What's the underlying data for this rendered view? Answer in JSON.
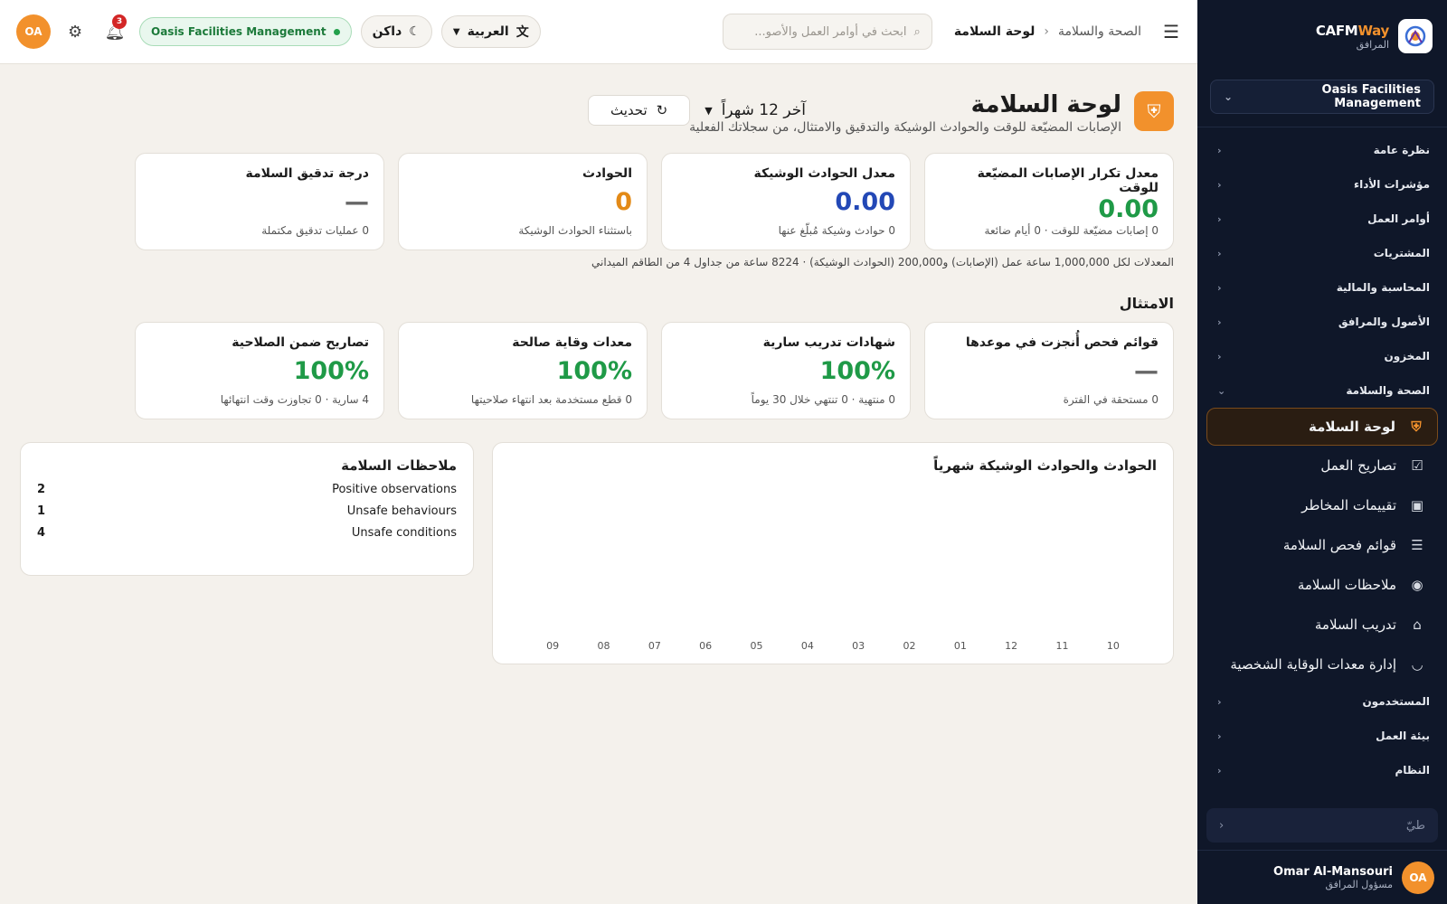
{
  "sidebar": {
    "brand": {
      "name_a": "CAFM",
      "name_b": "Way",
      "sub": "المرافق"
    },
    "tenant": "Oasis Facilities Management",
    "groups_top": [
      {
        "label": "نظرة عامة"
      },
      {
        "label": "مؤشرات الأداء"
      },
      {
        "label": "أوامر العمل"
      },
      {
        "label": "المشتريات"
      },
      {
        "label": "المحاسبة والمالية"
      },
      {
        "label": "الأصول والمرافق"
      },
      {
        "label": "المخزون"
      },
      {
        "label": "الصحة والسلامة"
      }
    ],
    "sub_items": [
      {
        "label": "لوحة السلامة",
        "icon": "shield-icon"
      },
      {
        "label": "تصاريح العمل",
        "icon": "checkbox-icon"
      },
      {
        "label": "تقييمات المخاطر",
        "icon": "chart-box-icon"
      },
      {
        "label": "قوائم فحص السلامة",
        "icon": "checklist-icon"
      },
      {
        "label": "ملاحظات السلامة",
        "icon": "eye-icon"
      },
      {
        "label": "تدريب السلامة",
        "icon": "graduation-cap-icon"
      },
      {
        "label": "إدارة معدات الوقاية الشخصية",
        "icon": "mask-icon"
      }
    ],
    "groups_bottom": [
      {
        "label": "المستخدمون"
      },
      {
        "label": "بيئة العمل"
      },
      {
        "label": "النظام"
      }
    ],
    "collapse_label": "طيّ",
    "user": {
      "initials": "OA",
      "name": "Omar Al-Mansouri",
      "role": "مسؤول المرافق"
    }
  },
  "topbar": {
    "breadcrumb_parent": "الصحة والسلامة",
    "breadcrumb_current": "لوحة السلامة",
    "search_placeholder": "ابحث في أوامر العمل والأصو...",
    "language": "العربية",
    "theme": "داكن",
    "tenant": "Oasis Facilities Management",
    "notifications": "3",
    "user_initials": "OA"
  },
  "page": {
    "title": "لوحة السلامة",
    "subtitle": "الإصابات المضيّعة للوقت والحوادث الوشيكة والتدقيق والامتثال، من سجلاتك الفعلية",
    "period": "آخر 12 شهراً",
    "refresh": "تحديث"
  },
  "kpis": [
    {
      "title": "معدل تكرار الإصابات المضيّعة للوقت",
      "value": "0.00",
      "note": "0 إصابات مضيّعة للوقت · 0 أيام ضائعة",
      "color": "#1f9a47"
    },
    {
      "title": "معدل الحوادث الوشيكة",
      "value": "0.00",
      "note": "0 حوادث وشيكة مُبلّغ عنها",
      "color": "#2348b6"
    },
    {
      "title": "الحوادث",
      "value": "0",
      "note": "باستثناء الحوادث الوشيكة",
      "color": "#e38a17"
    },
    {
      "title": "درجة تدقيق السلامة",
      "value": "—",
      "note": "0 عمليات تدقيق مكتملة",
      "color": "#666666"
    }
  ],
  "rates_note": "المعدلات لكل 1,000,000 ساعة عمل (الإصابات) و200,000 (الحوادث الوشيكة) · 8224 ساعة من جداول 4 من الطاقم الميداني",
  "compliance": {
    "title": "الامتثال",
    "cards": [
      {
        "title": "قوائم فحص أُنجزت في موعدها",
        "value": "—",
        "note": "0 مستحقة في الفترة",
        "color": "#666666"
      },
      {
        "title": "شهادات تدريب سارية",
        "value": "100%",
        "note": "0 منتهية · 0 تنتهي خلال 30 يوماً",
        "color": "#1f9a47"
      },
      {
        "title": "معدات وقاية صالحة",
        "value": "100%",
        "note": "0 قطع مستخدمة بعد انتهاء صلاحيتها",
        "color": "#1f9a47"
      },
      {
        "title": "تصاريح ضمن الصلاحية",
        "value": "100%",
        "note": "4 سارية · 0 تجاوزت وقت انتهائها",
        "color": "#1f9a47"
      }
    ]
  },
  "chart_data": {
    "type": "bar",
    "title": "الحوادث والحوادث الوشيكة شهرياً",
    "categories": [
      "10",
      "11",
      "12",
      "01",
      "02",
      "03",
      "04",
      "05",
      "06",
      "07",
      "08",
      "09"
    ],
    "values": [
      0,
      0,
      0,
      0,
      0,
      0,
      0,
      0,
      0,
      0,
      0,
      0
    ],
    "xlabel": "",
    "ylabel": ""
  },
  "observations": {
    "title": "ملاحظات السلامة",
    "items": [
      {
        "label": "Positive observations",
        "count": "2"
      },
      {
        "label": "Unsafe behaviours",
        "count": "1"
      },
      {
        "label": "Unsafe conditions",
        "count": "4"
      }
    ]
  }
}
